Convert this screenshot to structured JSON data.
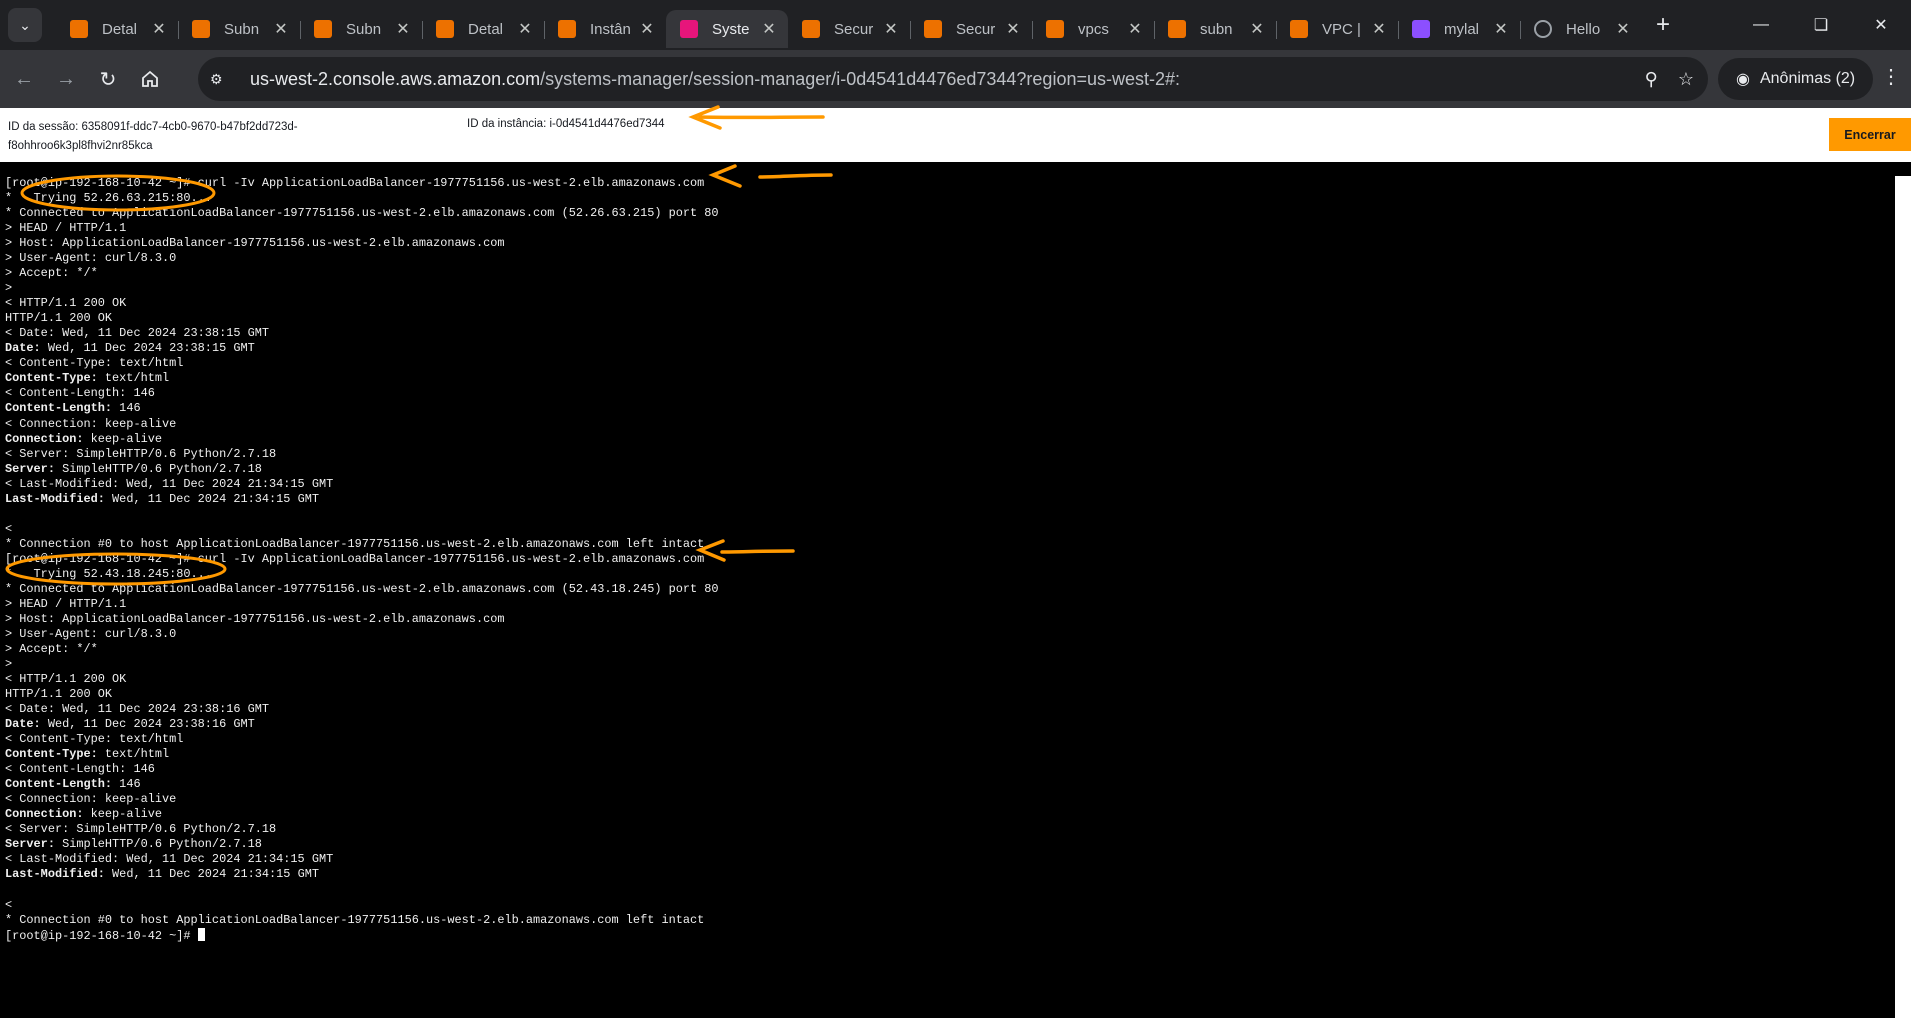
{
  "browser": {
    "tabs": [
      {
        "title": "Detal",
        "icon": "aws-service-icon",
        "color": "#ed7100",
        "active": false
      },
      {
        "title": "Subn",
        "icon": "aws-vpc-icon",
        "color": "#ed7100",
        "active": false
      },
      {
        "title": "Subn",
        "icon": "aws-vpc-icon",
        "color": "#ed7100",
        "active": false
      },
      {
        "title": "Detal",
        "icon": "aws-service-icon",
        "color": "#ed7100",
        "active": false
      },
      {
        "title": "Instân",
        "icon": "aws-service-icon",
        "color": "#ed7100",
        "active": false
      },
      {
        "title": "Syste",
        "icon": "systems-manager-icon",
        "color": "#e7157b",
        "active": true
      },
      {
        "title": "Secur",
        "icon": "aws-service-icon",
        "color": "#ed7100",
        "active": false
      },
      {
        "title": "Secur",
        "icon": "aws-service-icon",
        "color": "#ed7100",
        "active": false
      },
      {
        "title": "vpcs",
        "icon": "aws-vpc-icon",
        "color": "#ed7100",
        "active": false
      },
      {
        "title": "subn",
        "icon": "aws-vpc-icon",
        "color": "#ed7100",
        "active": false
      },
      {
        "title": "VPC |",
        "icon": "aws-vpc-icon",
        "color": "#ed7100",
        "active": false
      },
      {
        "title": "mylal",
        "icon": "purple-app-icon",
        "color": "#8c4fff",
        "active": false
      },
      {
        "title": "Hello",
        "icon": "globe-icon",
        "color": "#9aa0a6",
        "active": false
      }
    ],
    "url_host": "us-west-2.console.aws.amazon.com",
    "url_path": "/systems-manager/session-manager/i-0d4541d4476ed7344?region=us-west-2#:",
    "profile_label": "Anônimas (2)"
  },
  "session": {
    "session_id_text": "ID da sessão: 6358091f-ddc7-4cb0-9670-b47bf2dd723d-f8ohhroo6k3pl8fhvi2nr85kca",
    "instance_id_text": "ID da instância: i-0d4541d4476ed7344",
    "end_button_label": "Encerrar"
  },
  "terminal": {
    "lines": [
      {
        "t": "[root@ip-192-168-10-42 ~]# curl -Iv ApplicationLoadBalancer-1977751156.us-west-2.elb.amazonaws.com"
      },
      {
        "t": "*   Trying 52.26.63.215:80..."
      },
      {
        "t": "* Connected to ApplicationLoadBalancer-1977751156.us-west-2.elb.amazonaws.com (52.26.63.215) port 80"
      },
      {
        "t": "> HEAD / HTTP/1.1"
      },
      {
        "t": "> Host: ApplicationLoadBalancer-1977751156.us-west-2.elb.amazonaws.com"
      },
      {
        "t": "> User-Agent: curl/8.3.0"
      },
      {
        "t": "> Accept: */*"
      },
      {
        "t": ">"
      },
      {
        "t": "< HTTP/1.1 200 OK"
      },
      {
        "t": "HTTP/1.1 200 OK"
      },
      {
        "t": "< Date: Wed, 11 Dec 2024 23:38:15 GMT"
      },
      {
        "k": "Date:",
        "t": " Wed, 11 Dec 2024 23:38:15 GMT"
      },
      {
        "t": "< Content-Type: text/html"
      },
      {
        "k": "Content-Type:",
        "t": " text/html"
      },
      {
        "t": "< Content-Length: 146"
      },
      {
        "k": "Content-Length:",
        "t": " 146"
      },
      {
        "t": "< Connection: keep-alive"
      },
      {
        "k": "Connection:",
        "t": " keep-alive"
      },
      {
        "t": "< Server: SimpleHTTP/0.6 Python/2.7.18"
      },
      {
        "k": "Server:",
        "t": " SimpleHTTP/0.6 Python/2.7.18"
      },
      {
        "t": "< Last-Modified: Wed, 11 Dec 2024 21:34:15 GMT"
      },
      {
        "k": "Last-Modified:",
        "t": " Wed, 11 Dec 2024 21:34:15 GMT"
      },
      {
        "t": ""
      },
      {
        "t": "<"
      },
      {
        "t": "* Connection #0 to host ApplicationLoadBalancer-1977751156.us-west-2.elb.amazonaws.com left intact"
      },
      {
        "t": "[root@ip-192-168-10-42 ~]# curl -Iv ApplicationLoadBalancer-1977751156.us-west-2.elb.amazonaws.com"
      },
      {
        "t": "*   Trying 52.43.18.245:80..."
      },
      {
        "t": "* Connected to ApplicationLoadBalancer-1977751156.us-west-2.elb.amazonaws.com (52.43.18.245) port 80"
      },
      {
        "t": "> HEAD / HTTP/1.1"
      },
      {
        "t": "> Host: ApplicationLoadBalancer-1977751156.us-west-2.elb.amazonaws.com"
      },
      {
        "t": "> User-Agent: curl/8.3.0"
      },
      {
        "t": "> Accept: */*"
      },
      {
        "t": ">"
      },
      {
        "t": "< HTTP/1.1 200 OK"
      },
      {
        "t": "HTTP/1.1 200 OK"
      },
      {
        "t": "< Date: Wed, 11 Dec 2024 23:38:16 GMT"
      },
      {
        "k": "Date:",
        "t": " Wed, 11 Dec 2024 23:38:16 GMT"
      },
      {
        "t": "< Content-Type: text/html"
      },
      {
        "k": "Content-Type:",
        "t": " text/html"
      },
      {
        "t": "< Content-Length: 146"
      },
      {
        "k": "Content-Length:",
        "t": " 146"
      },
      {
        "t": "< Connection: keep-alive"
      },
      {
        "k": "Connection:",
        "t": " keep-alive"
      },
      {
        "t": "< Server: SimpleHTTP/0.6 Python/2.7.18"
      },
      {
        "k": "Server:",
        "t": " SimpleHTTP/0.6 Python/2.7.18"
      },
      {
        "t": "< Last-Modified: Wed, 11 Dec 2024 21:34:15 GMT"
      },
      {
        "k": "Last-Modified:",
        "t": " Wed, 11 Dec 2024 21:34:15 GMT"
      },
      {
        "t": ""
      },
      {
        "t": "<"
      },
      {
        "t": "* Connection #0 to host ApplicationLoadBalancer-1977751156.us-west-2.elb.amazonaws.com left intact"
      },
      {
        "t": "[root@ip-192-168-10-42 ~]# ",
        "cursor": true
      }
    ]
  },
  "colors": {
    "annotation": "#ff9900",
    "end_button": "#ff9900",
    "terminal_bg": "#000000"
  }
}
